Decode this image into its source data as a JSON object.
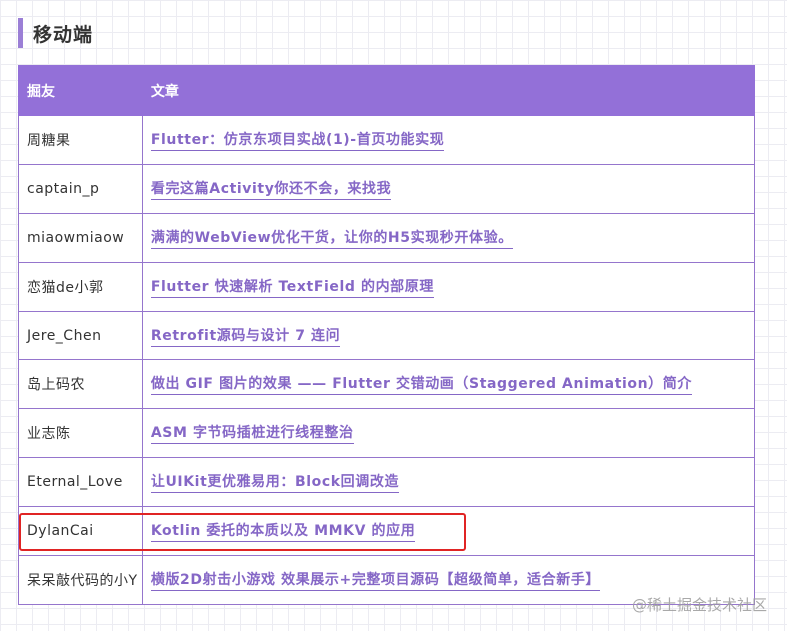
{
  "section": {
    "title": "移动端"
  },
  "table": {
    "headers": {
      "user": "掘友",
      "article": "文章"
    },
    "rows": [
      {
        "user": "周糖果",
        "article": "Flutter：仿京东项目实战(1)-首页功能实现"
      },
      {
        "user": "captain_p",
        "article": "看完这篇Activity你还不会，来找我"
      },
      {
        "user": "miaowmiaow",
        "article": "满满的WebView优化干货，让你的H5实现秒开体验。"
      },
      {
        "user": "恋猫de小郭",
        "article": "Flutter 快速解析 TextField 的内部原理"
      },
      {
        "user": "Jere_Chen",
        "article": "Retrofit源码与设计 7 连问"
      },
      {
        "user": "岛上码农",
        "article": "做出 GIF 图片的效果 —— Flutter 交错动画（Staggered Animation）简介"
      },
      {
        "user": "业志陈",
        "article": "ASM 字节码插桩进行线程整治"
      },
      {
        "user": "Eternal_Love",
        "article": "让UIKit更优雅易用：Block回调改造"
      },
      {
        "user": "DylanCai",
        "article": "Kotlin 委托的本质以及 MMKV 的应用"
      },
      {
        "user": "呆呆敲代码的小Y",
        "article": "横版2D射击小游戏 效果展示+完整项目源码【超级简单，适合新手】"
      }
    ]
  },
  "watermark": "@稀土掘金技术社区",
  "colors": {
    "accent": "#9370d8",
    "link": "#8567c6",
    "highlight": "#e02424"
  }
}
